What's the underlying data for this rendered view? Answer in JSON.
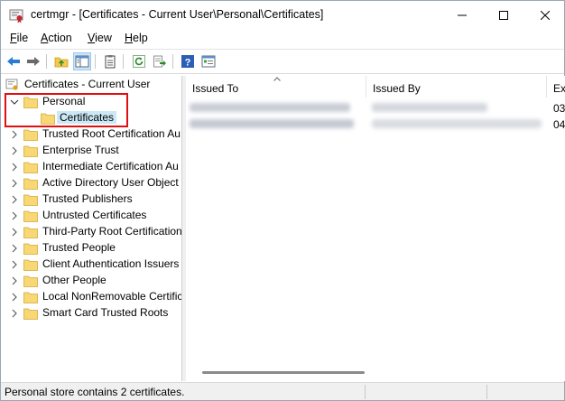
{
  "window": {
    "title": "certmgr - [Certificates - Current User\\Personal\\Certificates]",
    "app_icon": "certificate-manager-icon"
  },
  "menu": {
    "file": "File",
    "action": "Action",
    "view": "View",
    "help": "Help"
  },
  "toolbar": {
    "icons": [
      "back-arrow-icon",
      "forward-arrow-icon",
      "up-folder-icon",
      "show-hide-tree-icon",
      "clipboard-icon",
      "refresh-icon",
      "export-list-icon",
      "help-icon",
      "properties-icon"
    ]
  },
  "tree": {
    "root": "Certificates - Current User",
    "personal": "Personal",
    "personal_child": "Certificates",
    "items": [
      "Trusted Root Certification Au",
      "Enterprise Trust",
      "Intermediate Certification Au",
      "Active Directory User Object",
      "Trusted Publishers",
      "Untrusted Certificates",
      "Third-Party Root Certification",
      "Trusted People",
      "Client Authentication Issuers",
      "Other People",
      "Local NonRemovable Certific",
      "Smart Card Trusted Roots"
    ]
  },
  "list": {
    "columns": {
      "issued_to": "Issued To",
      "issued_by": "Issued By",
      "expiration": "Ex"
    },
    "rows": [
      {
        "expiration": "03"
      },
      {
        "expiration": "04"
      }
    ]
  },
  "status": {
    "text": "Personal store contains 2 certificates."
  },
  "colors": {
    "selection": "#cce8f6",
    "highlight_box": "#e01010",
    "folder": "#f5c84c"
  }
}
